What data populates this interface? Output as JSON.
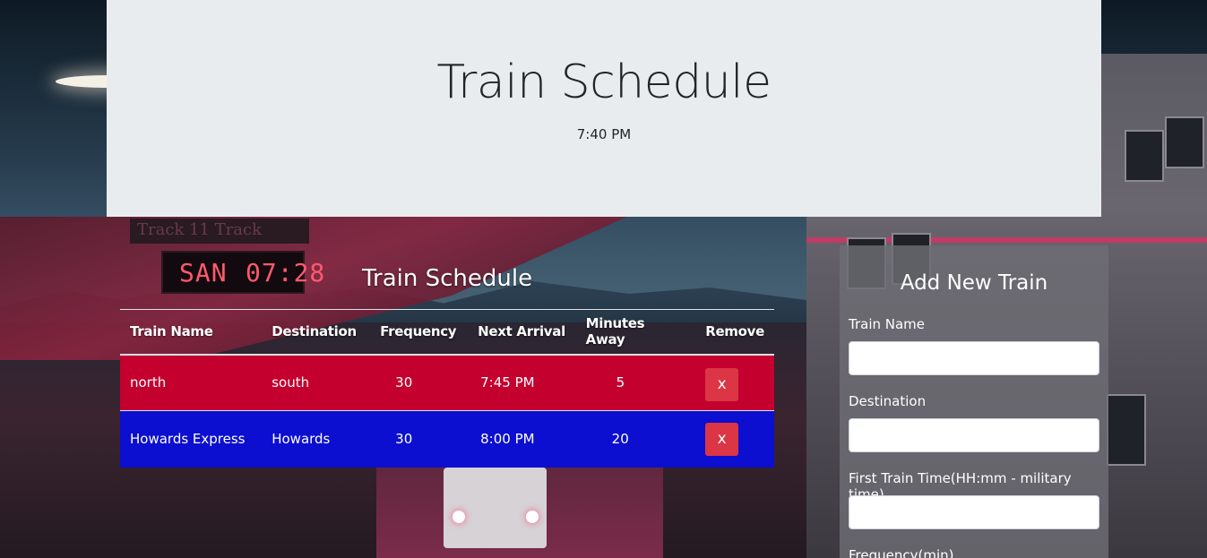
{
  "header": {
    "title": "Train Schedule",
    "current_time": "7:40 PM"
  },
  "background": {
    "led_station": "SAN",
    "led_time": "07:28",
    "track_sign": "Track 11  Track"
  },
  "schedule": {
    "title": "Train Schedule",
    "columns": [
      "Train Name",
      "Destination",
      "Frequency",
      "Next Arrival",
      "Minutes Away",
      "Remove"
    ],
    "rows": [
      {
        "name": "north",
        "destination": "south",
        "frequency": "30",
        "next_arrival": "7:45 PM",
        "minutes_away": "5",
        "remove_label": "x",
        "color": "#c4002f"
      },
      {
        "name": "Howards Express",
        "destination": "Howards",
        "frequency": "30",
        "next_arrival": "8:00 PM",
        "minutes_away": "20",
        "remove_label": "x",
        "color": "#0c0fd0"
      }
    ]
  },
  "form": {
    "title": "Add New Train",
    "fields": [
      {
        "label": "Train Name",
        "value": ""
      },
      {
        "label": "Destination",
        "value": ""
      },
      {
        "label": "First Train Time(HH:mm - military time)",
        "value": ""
      },
      {
        "label": "Frequency(min)",
        "value": ""
      }
    ]
  },
  "colors": {
    "jumbotron_bg": "#e9ecef",
    "remove_button": "#dc3545",
    "row_red": "#c4002f",
    "row_blue": "#0c0fd0"
  }
}
